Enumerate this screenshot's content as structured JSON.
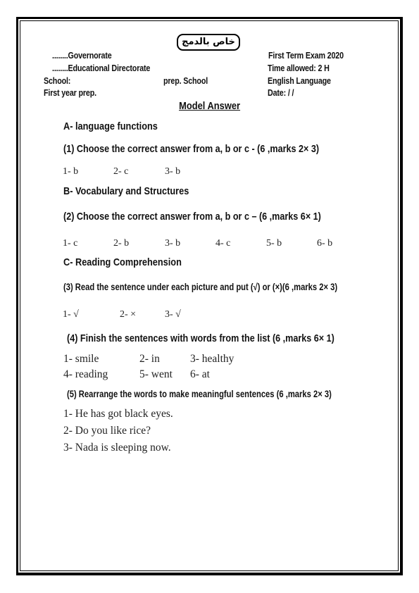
{
  "badge": "خاص بالدمج",
  "header": {
    "left": {
      "governorate": "........Governorate",
      "directorate": "........Educational Directorate",
      "school": "School:",
      "school_type": "prep. School",
      "grade": "First year prep."
    },
    "right": {
      "exam": "First Term Exam 2020",
      "time": "Time allowed: 2 H",
      "subject": "English Language",
      "date": "Date:     /     /"
    }
  },
  "title": "Model Answer",
  "sections": [
    {
      "heading": "A- language functions",
      "questions": [
        {
          "text": "(1) Choose the correct answer from a, b or c - (6 ,marks 2× 3)",
          "answers": [
            "1- b",
            "2- c",
            "3- b"
          ]
        }
      ]
    },
    {
      "heading": "B- Vocabulary and Structures",
      "questions": [
        {
          "text": "(2) Choose the correct answer from a, b or c – (6 ,marks 6× 1)",
          "answers": [
            "1- c",
            "2- b",
            "3- b",
            "4- c",
            "5- b",
            "6- b"
          ]
        }
      ]
    },
    {
      "heading": "C- Reading Comprehension",
      "questions": [
        {
          "text": "(3) Read the sentence under each picture and put (√) or (×)(6 ,marks 2× 3)",
          "answers": [
            "1- √",
            "2- ×",
            "3- √"
          ]
        },
        {
          "text": "(4) Finish the sentences with words from the list (6 ,marks 6× 1)",
          "answers": [
            "1- smile",
            "2- in",
            "3- healthy",
            "4- reading",
            "5- went",
            "6- at"
          ]
        },
        {
          "text": "(5) Rearrange the words to make meaningful sentences (6 ,marks 2× 3)",
          "answers": [
            "1- He has got black eyes.",
            "2- Do you like rice?",
            "3- Nada is sleeping now."
          ]
        }
      ]
    }
  ]
}
